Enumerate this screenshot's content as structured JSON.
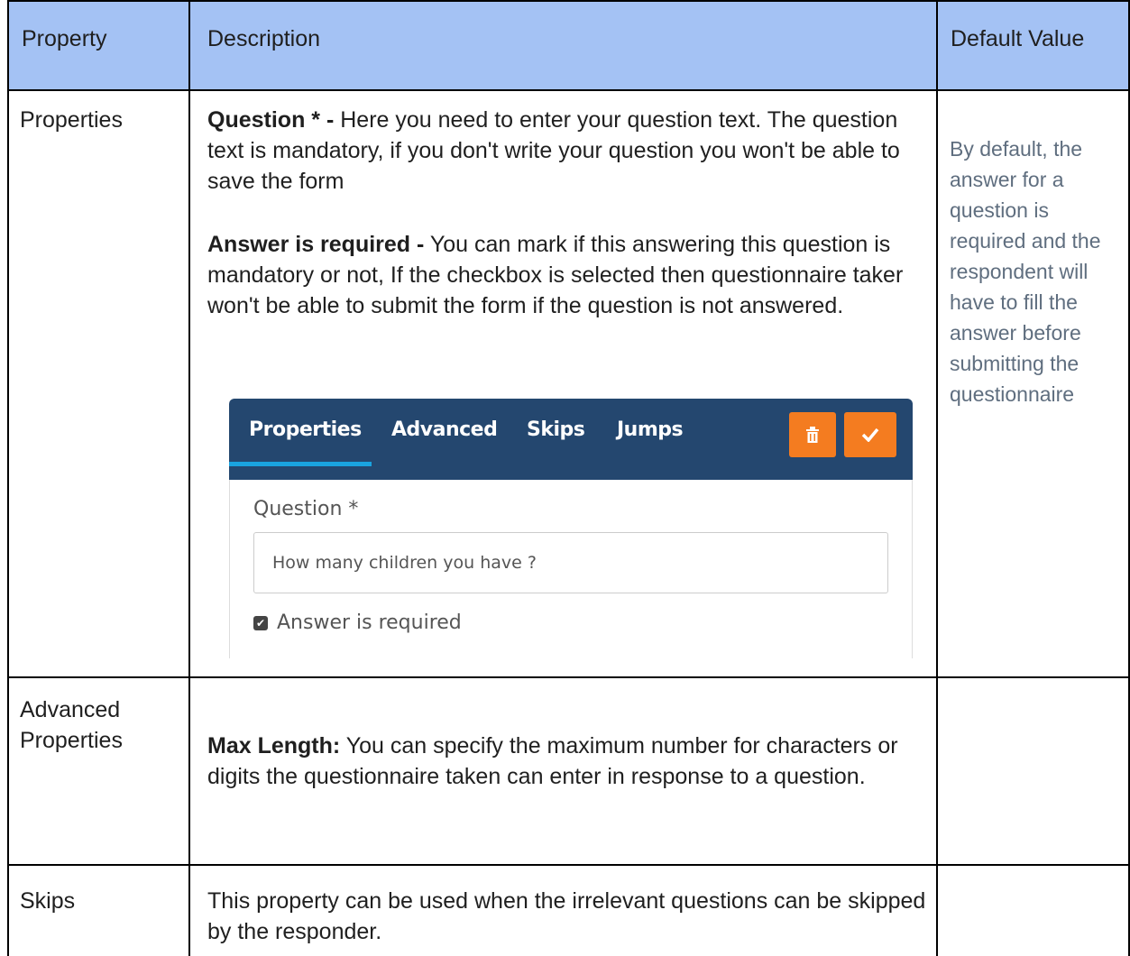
{
  "header": {
    "col1": "Property",
    "col2": "Description",
    "col3": "Default Value"
  },
  "rows": [
    {
      "property": "Properties",
      "paragraphs": [
        {
          "bold": "Question * -",
          "text": " Here you need to enter your question text. The question text is mandatory, if you don't write your question you won't be able to save the form"
        },
        {
          "bold": "Answer is required -",
          "text": " You can mark if this answering this question is mandatory or not, If the checkbox is selected then questionnaire taker won't be able to submit the form if the question is not answered."
        }
      ],
      "default": "By default, the answer for a question is required and the respondent will have to fill the answer before submitting the questionnaire"
    },
    {
      "property": "Advanced Properties",
      "paragraphs": [
        {
          "bold": "Max Length:",
          "text": " You can specify the maximum number for characters or digits the questionnaire taken can enter in response to a question."
        }
      ],
      "default": ""
    },
    {
      "property": "Skips",
      "paragraphs": [
        {
          "bold": "",
          "text": "This property can be used when the irrelevant questions can be skipped by the responder."
        }
      ],
      "default": ""
    }
  ],
  "screenshot": {
    "tabs": [
      "Properties",
      "Advanced",
      "Skips",
      "Jumps"
    ],
    "delete_icon": "trash-icon",
    "confirm_icon": "check-icon",
    "question_label": "Question *",
    "question_value": "How many children you have ?",
    "required_label": "Answer is required",
    "required_checked": true,
    "colors": {
      "bar": "#24476f",
      "accent": "#f47c20",
      "tab_underline": "#1aa3df",
      "header": "#a4c2f4"
    }
  }
}
